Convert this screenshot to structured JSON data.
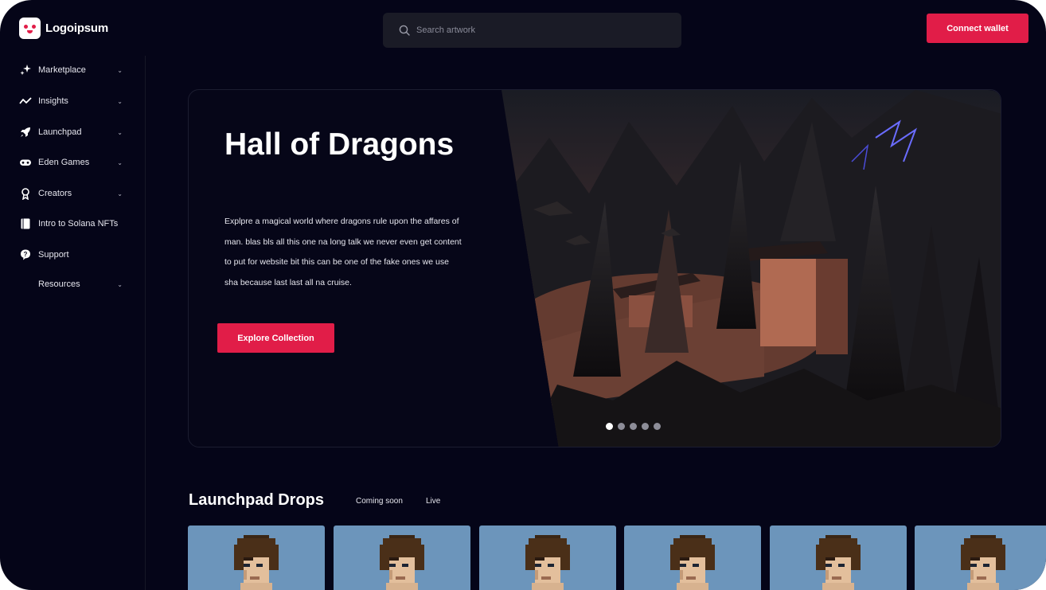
{
  "header": {
    "logo_text": "Logoipsum",
    "search_placeholder": "Search artwork",
    "connect_label": "Connect wallet"
  },
  "sidebar": {
    "items": [
      {
        "label": "Marketplace",
        "icon": "sparkle-icon",
        "has_chevron": true
      },
      {
        "label": "Insights",
        "icon": "trend-line-icon",
        "has_chevron": true
      },
      {
        "label": "Launchpad",
        "icon": "rocket-icon",
        "has_chevron": true
      },
      {
        "label": "Eden Games",
        "icon": "gamepad-icon",
        "has_chevron": true
      },
      {
        "label": "Creators",
        "icon": "award-icon",
        "has_chevron": true
      },
      {
        "label": "Intro to Solana NFTs",
        "icon": "book-icon",
        "has_chevron": false
      },
      {
        "label": "Support",
        "icon": "help-icon",
        "has_chevron": false
      },
      {
        "label": "Resources",
        "icon": "",
        "has_chevron": true
      }
    ],
    "chevron": "⌄"
  },
  "hero": {
    "title": "Hall of Dragons",
    "description": "Explpre a magical world where dragons rule upon the affares of man. blas bls all this one na long talk we never even get content to put for website bit this can be one of the fake ones we use sha because last last all na cruise.",
    "cta_label": "Explore Collection",
    "slides_total": 5,
    "active_slide": 1
  },
  "drops": {
    "title": "Launchpad Drops",
    "tabs": [
      "Coming soon",
      "Live"
    ],
    "cards_count": 6
  },
  "colors": {
    "background": "#050518",
    "accent": "#e11d48",
    "card_bg": "#6c95bb"
  }
}
